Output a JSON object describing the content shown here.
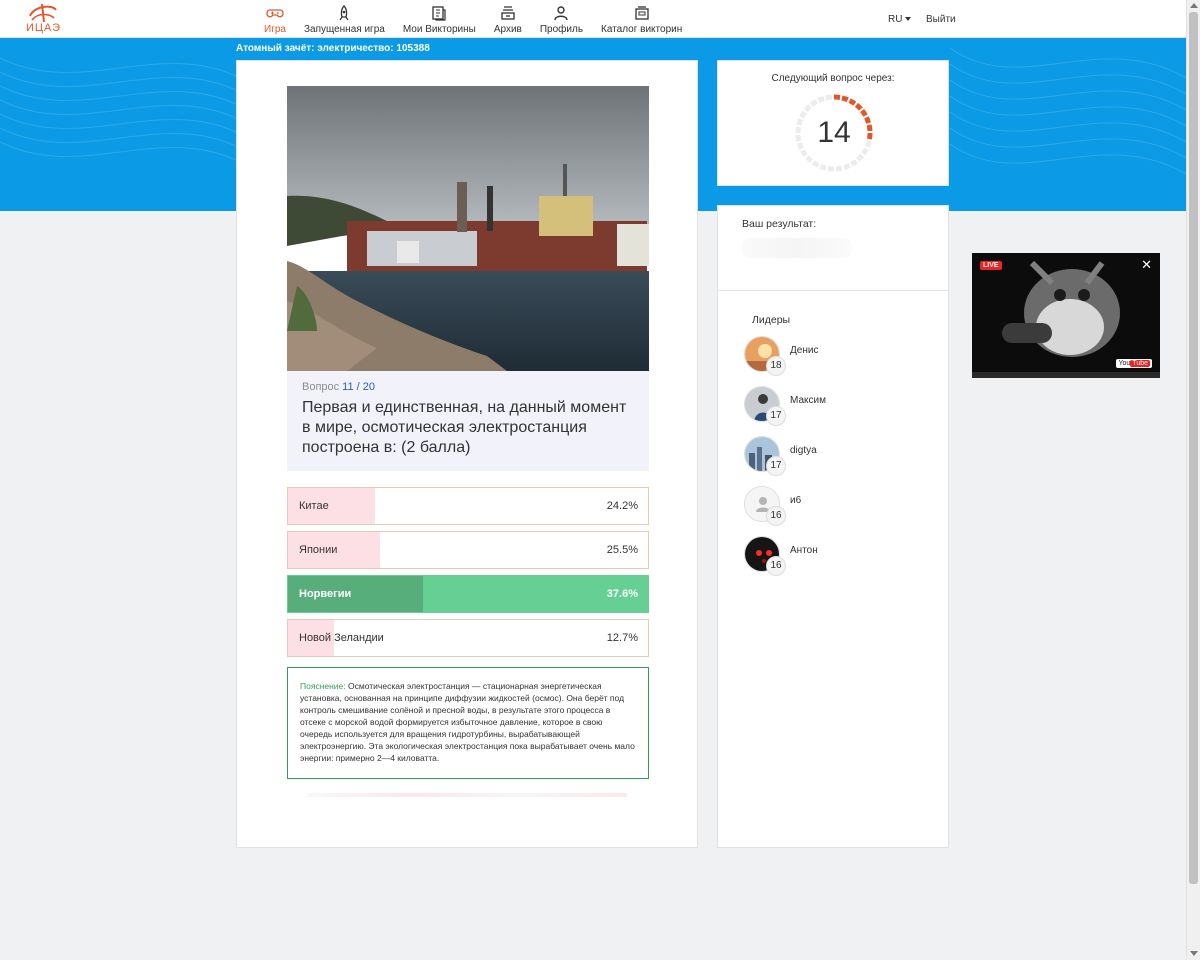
{
  "brand": {
    "logo_text": "ИЦАЭ"
  },
  "nav": {
    "items": [
      {
        "label": "Игра",
        "icon": "gamepad-icon",
        "active": true
      },
      {
        "label": "Запущенная игра",
        "icon": "rocket-icon"
      },
      {
        "label": "Мои Викторины",
        "icon": "copy-icon"
      },
      {
        "label": "Архив",
        "icon": "archive-icon"
      },
      {
        "label": "Профиль",
        "icon": "user-icon"
      },
      {
        "label": "Каталог викторин",
        "icon": "catalog-icon"
      }
    ],
    "language": "RU",
    "logout": "Выйти"
  },
  "game": {
    "subtitle": "Атомный зачёт: электричество: 105388"
  },
  "question": {
    "prefix": "Вопрос",
    "number": "11 / 20",
    "text": "Первая и единственная, на данный момент в мире, осмотическая электростанция построена в: (2 балла)"
  },
  "answers": [
    {
      "label": "Китае",
      "percent": "24.2%",
      "share": 0.242,
      "correct": false
    },
    {
      "label": "Японии",
      "percent": "25.5%",
      "share": 0.255,
      "correct": false
    },
    {
      "label": "Норвегии",
      "percent": "37.6%",
      "share": 0.376,
      "correct": true
    },
    {
      "label": "Новой Зеландии",
      "percent": "12.7%",
      "share": 0.127,
      "correct": false
    }
  ],
  "explanation": {
    "lead": "Пояснение:",
    "text": "Осмотическая электростанция — стационарная энергетическая установка, основанная на принципе диффузии жидкостей (осмос). Она берёт под контроль смешивание солёной и пресной воды, в результате этого процесса в отсеке с морской водой формируется избыточное давление, которое в свою очередь используется для вращения гидротурбины, вырабатывающей электроэнергию. Эта экологическая электростанция пока вырабатывает очень мало энергии: примерно 2—4 киловатта."
  },
  "timer": {
    "title": "Следующий вопрос через:",
    "value": "14",
    "remaining_fraction": 0.28
  },
  "results": {
    "title": "Ваш результат:"
  },
  "leaders": {
    "title": "Лидеры",
    "items": [
      {
        "name": "Денис",
        "score": "18",
        "avatar": "sunset-avatar"
      },
      {
        "name": "Максим",
        "score": "17",
        "avatar": "person-avatar"
      },
      {
        "name": "digtya",
        "score": "17",
        "avatar": "city-avatar"
      },
      {
        "name": "и6",
        "score": "16",
        "avatar": "default-avatar"
      },
      {
        "name": "Антон",
        "score": "16",
        "avatar": "red-lights-avatar"
      }
    ]
  },
  "video": {
    "live_label": "LIVE",
    "close": "✕",
    "brand_you": "You",
    "brand_tube": "Tube"
  },
  "colors": {
    "accent": "#e2572a",
    "hero_blue": "#0b9be6",
    "correct_green": "#66d094",
    "wrong_fill": "#fde0e6"
  }
}
